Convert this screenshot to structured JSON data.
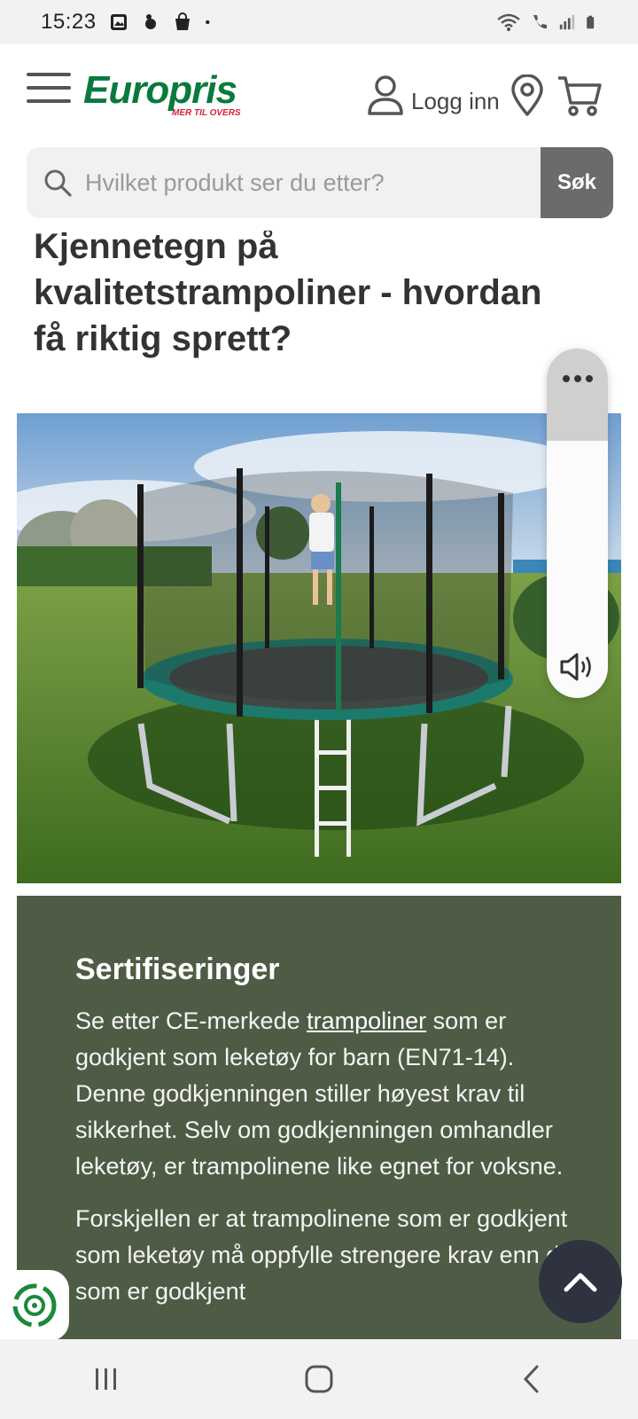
{
  "status_bar": {
    "time": "15:23",
    "left_icons": [
      "image-icon",
      "hand-icon",
      "shopping-bag-icon",
      "dot-icon"
    ],
    "right_icons": [
      "wifi-icon",
      "call-icon",
      "signal-icon",
      "battery-icon"
    ]
  },
  "header": {
    "logo_text": "Europris",
    "logo_tagline": "MER TIL OVERS",
    "login_label": "Logg inn",
    "brand_green": "#0a7a3c",
    "brand_red": "#d81f3a"
  },
  "search": {
    "placeholder": "Hvilket produkt ser du etter?",
    "button_label": "Søk"
  },
  "article": {
    "title": "Kjennetegn på kvalitetstrampoliner - hvordan få riktig sprett?",
    "hero_image_alt": "Barn hopper på trampoline med sikkerhetsnett i en hage"
  },
  "infobox": {
    "heading": "Sertifiseringer",
    "p1_before": "Se etter CE-merkede ",
    "p1_link": "trampoliner",
    "p1_after": " som er godkjent som leketøy for barn (EN71-14). Denne godkjenningen stiller høyest krav til sikkerhet. Selv om godkjenningen omhandler leketøy, er trampolinene like egnet for voksne.",
    "p2": "Forskjellen er at trampolinene som er godkjent som leketøy må oppfylle strengere krav enn de som er godkjent",
    "background": "#4f5c45"
  },
  "widgets": {
    "audio_menu_icon": "more-dots-icon",
    "audio_icon": "speaker-icon",
    "scroll_top_icon": "chevron-up-icon",
    "recycle_icon": "recycle-icon"
  },
  "nav_bar": {
    "buttons": [
      "recents-icon",
      "home-icon",
      "back-icon"
    ]
  }
}
